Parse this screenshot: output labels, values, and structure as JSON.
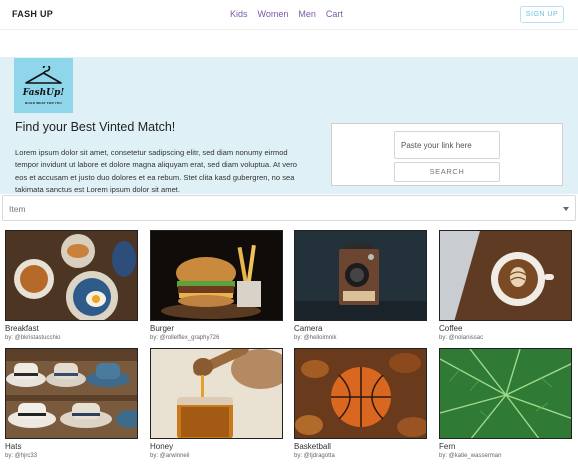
{
  "header": {
    "brand": "FASH UP",
    "nav": [
      "Kids",
      "Women",
      "Men",
      "Cart"
    ],
    "signup": "SIGN UP"
  },
  "hero": {
    "logo_text": "FashUp!",
    "logo_tagline": "BUILD WHAT FOR YOU",
    "title": "Find your Best Vinted Match!",
    "body": "Lorem ipsum dolor sit amet, consetetur sadipscing elitr, sed diam nonumy eirmod tempor invidunt ut labore et dolore magna aliquyam erat, sed diam voluptua. At vero eos et accusam et justo duo dolores et ea rebum. Stet clita kasd gubergren, no sea takimata sanctus est Lorem ipsum dolor sit amet.",
    "link_placeholder": "Paste your link here",
    "search_label": "SEARCH"
  },
  "filter": {
    "label": "Item"
  },
  "gallery": [
    {
      "title": "Breakfast",
      "author": "by: @bkristastucchio",
      "icon": "breakfast-photo"
    },
    {
      "title": "Burger",
      "author": "by: @rollelflex_graphy726",
      "icon": "burger-photo"
    },
    {
      "title": "Camera",
      "author": "by: @helloimnik",
      "icon": "camera-photo"
    },
    {
      "title": "Coffee",
      "author": "by: @nolanissac",
      "icon": "coffee-photo"
    },
    {
      "title": "Hats",
      "author": "by: @hjrc33",
      "icon": "hats-photo"
    },
    {
      "title": "Honey",
      "author": "by: @arwinneil",
      "icon": "honey-photo"
    },
    {
      "title": "Basketball",
      "author": "by: @tjdragotta",
      "icon": "basketball-photo"
    },
    {
      "title": "Fern",
      "author": "by: @katie_wasserman",
      "icon": "fern-photo"
    }
  ],
  "colors": {
    "hero_bg": "#dff1f7",
    "logo_bg": "#8fd6ea",
    "nav_link": "#7a5aa8",
    "signup_accent": "#66c3db"
  }
}
